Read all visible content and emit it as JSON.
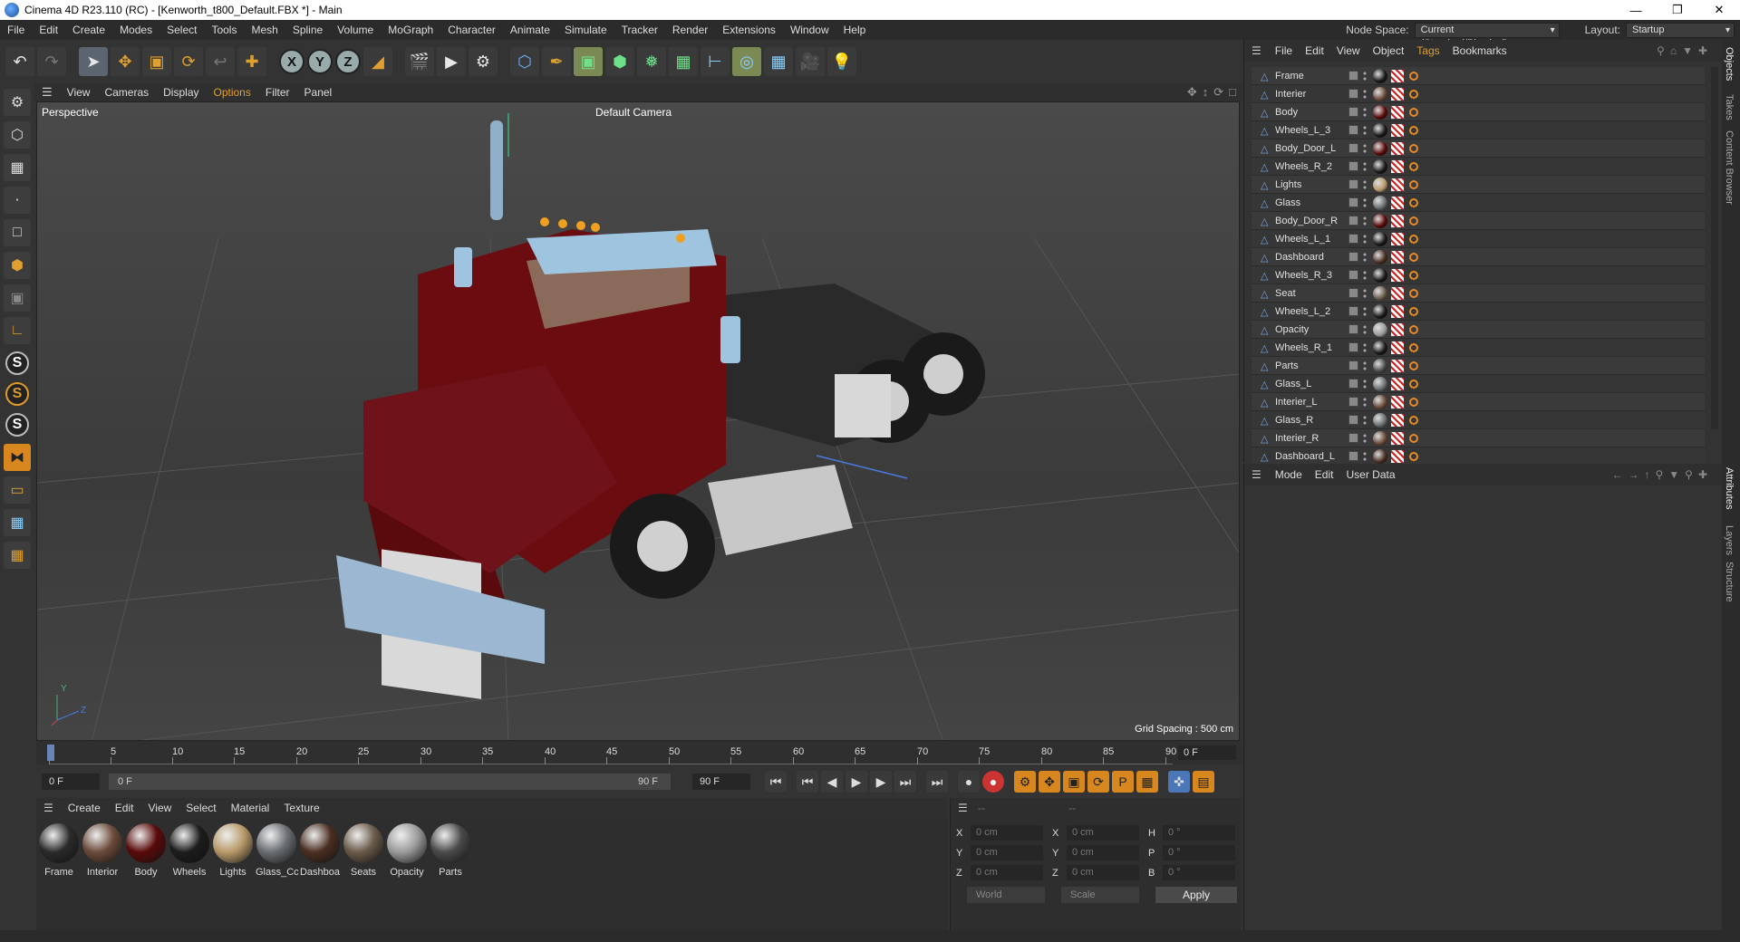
{
  "window": {
    "title": "Cinema 4D R23.110 (RC) - [Kenworth_t800_Default.FBX *] - Main"
  },
  "menubar": {
    "items": [
      "File",
      "Edit",
      "Create",
      "Modes",
      "Select",
      "Tools",
      "Mesh",
      "Spline",
      "Volume",
      "MoGraph",
      "Character",
      "Animate",
      "Simulate",
      "Tracker",
      "Render",
      "Extensions",
      "Window",
      "Help"
    ],
    "node_space_label": "Node Space:",
    "node_space_value": "Current (Standard/Physical)",
    "layout_label": "Layout:",
    "layout_value": "Startup"
  },
  "viewport": {
    "menu": [
      "View",
      "Cameras",
      "Display",
      "Options",
      "Filter",
      "Panel"
    ],
    "label": "Perspective",
    "camera": "Default Camera",
    "grid_spacing": "Grid Spacing : 500 cm",
    "axis_y": "Y",
    "axis_z": "Z"
  },
  "timeline": {
    "ticks": [
      "0",
      "5",
      "10",
      "15",
      "20",
      "25",
      "30",
      "35",
      "40",
      "45",
      "50",
      "55",
      "60",
      "65",
      "70",
      "75",
      "80",
      "85",
      "90"
    ],
    "frame_value": "0 F"
  },
  "transport": {
    "start_field": "0 F",
    "slider_left": "0 F",
    "slider_right": "90 F",
    "end_field": "90 F"
  },
  "material_manager": {
    "menu": [
      "Create",
      "Edit",
      "View",
      "Select",
      "Material",
      "Texture"
    ],
    "materials": [
      {
        "name": "Frame",
        "color": "#2a2a2a"
      },
      {
        "name": "Interior",
        "color": "#6b4a3a"
      },
      {
        "name": "Body",
        "color": "#5a0a0a"
      },
      {
        "name": "Wheels",
        "color": "#1c1c1c"
      },
      {
        "name": "Lights",
        "color": "#b89a6a"
      },
      {
        "name": "Glass_Cc",
        "color": "#6a6e72"
      },
      {
        "name": "Dashboa",
        "color": "#4a2e22"
      },
      {
        "name": "Seats",
        "color": "#6a5a4a"
      },
      {
        "name": "Opacity",
        "color": "#9a9a9a"
      },
      {
        "name": "Parts",
        "color": "#4a4a4a"
      }
    ]
  },
  "coordinates": {
    "header_left": "--",
    "header_right": "--",
    "rows": [
      {
        "a": "X",
        "av": "0 cm",
        "b": "X",
        "bv": "0 cm",
        "c": "H",
        "cv": "0 °"
      },
      {
        "a": "Y",
        "av": "0 cm",
        "b": "Y",
        "bv": "0 cm",
        "c": "P",
        "cv": "0 °"
      },
      {
        "a": "Z",
        "av": "0 cm",
        "b": "Z",
        "bv": "0 cm",
        "c": "B",
        "cv": "0 °"
      }
    ],
    "mode_world": "World",
    "mode_scale": "Scale",
    "apply": "Apply"
  },
  "object_manager": {
    "menu": [
      "File",
      "Edit",
      "View",
      "Object",
      "Tags",
      "Bookmarks"
    ],
    "objects": [
      {
        "name": "Frame",
        "mat": "#1a1a1a"
      },
      {
        "name": "Interier",
        "mat": "#6b4a3a"
      },
      {
        "name": "Body",
        "mat": "#5a0a0a"
      },
      {
        "name": "Wheels_L_3",
        "mat": "#1a1a1a"
      },
      {
        "name": "Body_Door_L",
        "mat": "#5a0a0a"
      },
      {
        "name": "Wheels_R_2",
        "mat": "#1a1a1a"
      },
      {
        "name": "Lights",
        "mat": "#b89a6a"
      },
      {
        "name": "Glass",
        "mat": "#6a6e72"
      },
      {
        "name": "Body_Door_R",
        "mat": "#5a0a0a"
      },
      {
        "name": "Wheels_L_1",
        "mat": "#1a1a1a"
      },
      {
        "name": "Dashboard",
        "mat": "#4a2e22"
      },
      {
        "name": "Wheels_R_3",
        "mat": "#1a1a1a"
      },
      {
        "name": "Seat",
        "mat": "#6a5a4a"
      },
      {
        "name": "Wheels_L_2",
        "mat": "#1a1a1a"
      },
      {
        "name": "Opacity",
        "mat": "#9a9a9a"
      },
      {
        "name": "Wheels_R_1",
        "mat": "#1a1a1a"
      },
      {
        "name": "Parts",
        "mat": "#4a4a4a"
      },
      {
        "name": "Glass_L",
        "mat": "#6a6e72"
      },
      {
        "name": "Interier_L",
        "mat": "#6b4a3a"
      },
      {
        "name": "Glass_R",
        "mat": "#6a6e72"
      },
      {
        "name": "Interier_R",
        "mat": "#6b4a3a"
      },
      {
        "name": "Dashboard_L",
        "mat": "#4a2e22"
      }
    ]
  },
  "attribute_manager": {
    "menu": [
      "Mode",
      "Edit",
      "User Data"
    ]
  },
  "side_tabs": {
    "objects": "Objects",
    "takes": "Takes",
    "content_browser": "Content Browser",
    "attributes": "Attributes",
    "layers": "Layers",
    "structure": "Structure"
  }
}
